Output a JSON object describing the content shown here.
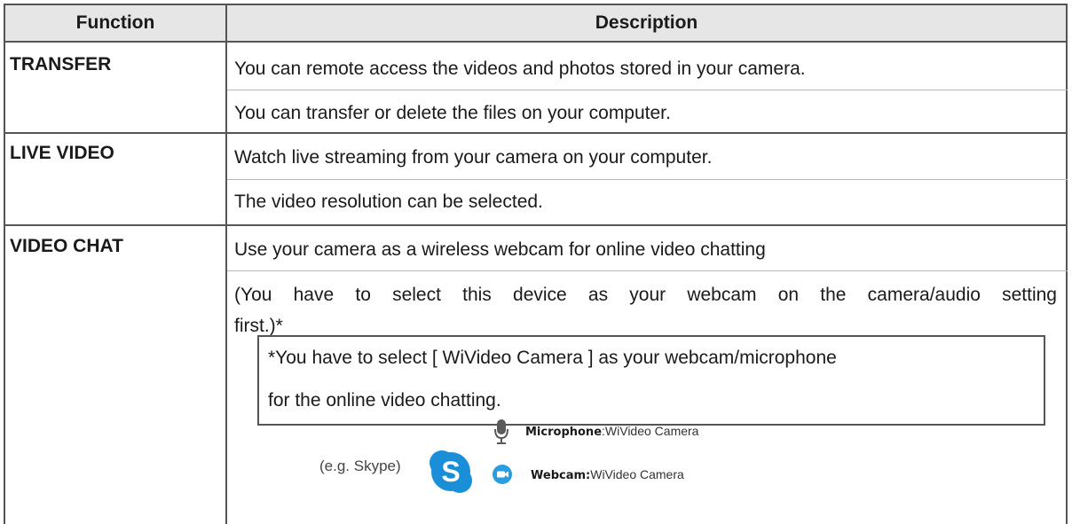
{
  "header": {
    "function": "Function",
    "description": "Description"
  },
  "rows": [
    {
      "name": "TRANSFER",
      "lines": [
        "You can remote access the videos and photos stored in your camera.",
        "You can transfer or delete the files on your computer."
      ]
    },
    {
      "name": "LIVE VIDEO",
      "lines": [
        "Watch live streaming from your camera on your computer.",
        "The video resolution can be selected."
      ]
    },
    {
      "name": "VIDEO CHAT",
      "lines": [
        "Use your camera as a wireless webcam for online video chatting",
        "(You have to select this device as your webcam on the camera/audio setting",
        "first.)*"
      ]
    }
  ],
  "note": {
    "line1": "*You have to select [ WiVideo Camera ] as your webcam/microphone",
    "line2": "for the online video chatting."
  },
  "example": {
    "label": "(e.g. Skype)",
    "microphone_label": "Microphone",
    "microphone_value": ":WiVideo Camera",
    "webcam_label": "Webcam:",
    "webcam_value": "WiVideo Camera"
  },
  "colors": {
    "header_bg": "#e6e6e6",
    "skype_blue": "#1a8fd8",
    "webcam_blue": "#2a9de0",
    "mic_grey": "#5a5a5a"
  }
}
